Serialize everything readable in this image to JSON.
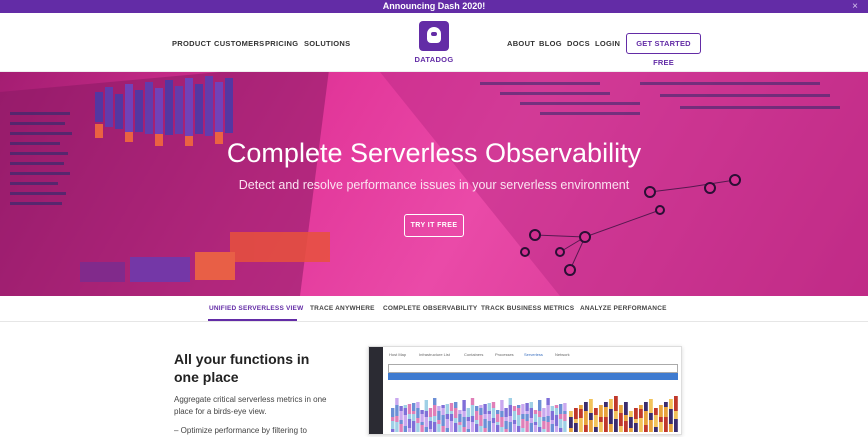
{
  "announcement": {
    "text": "Announcing Dash 2020!",
    "close_glyph": "×"
  },
  "nav": {
    "left": [
      "PRODUCT",
      "CUSTOMERS",
      "PRICING",
      "SOLUTIONS"
    ],
    "logo_text": "DATADOG",
    "right": [
      "ABOUT",
      "BLOG",
      "DOCS",
      "LOGIN"
    ],
    "cta": "GET STARTED FREE"
  },
  "hero": {
    "title": "Complete Serverless Observability",
    "subtitle": "Detect and resolve performance issues in your serverless environment",
    "button": "TRY IT FREE"
  },
  "tabs": [
    "UNIFIED SERVERLESS VIEW",
    "TRACE ANYWHERE",
    "COMPLETE OBSERVABILITY",
    "TRACK BUSINESS METRICS",
    "ANALYZE PERFORMANCE"
  ],
  "active_tab": 0,
  "section": {
    "heading": "All your functions in one place",
    "body": "Aggregate critical serverless metrics in one place for a birds-eye view.",
    "bullet": "– Optimize performance by filtering to"
  },
  "screenshot": {
    "tabs": [
      "Host Map",
      "Infrastructure List",
      "Containers",
      "Processes",
      "Serverless",
      "Network"
    ],
    "active_tab": 4
  },
  "colors": {
    "brand": "#632ca6",
    "hero_pink": "#e2379a"
  }
}
